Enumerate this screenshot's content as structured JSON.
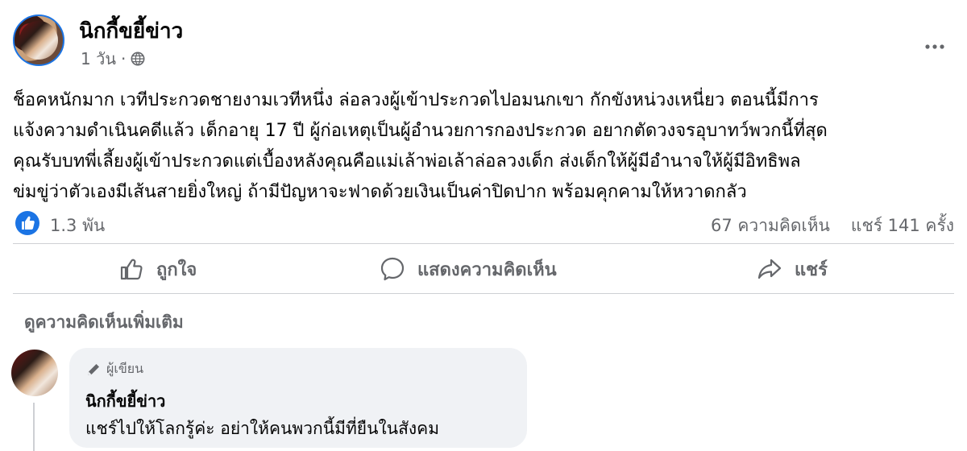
{
  "post": {
    "author": "นิกกี้ขยี้ข่าว",
    "time": "1 วัน",
    "separator": "·",
    "privacy_icon": "globe-icon",
    "more_icon": "more-horizontal-icon",
    "lines": [
      "ช็อคหนักมาก เวทีประกวดชายงามเวทีหนึ่ง ล่อลวงผู้เข้าประกวดไปอมนกเขา กักขังหน่วงเหนี่ยว ตอนนี้มีการ",
      "แจ้งความดำเนินคดีแล้ว เด็กอายุ 17 ปี ผู้ก่อเหตุเป็นผู้อำนวยการกองประกวด อยากตัดวงจรอุบาทว์พวกนี้ที่สุด",
      "คุณรับบทพี่เลี้ยงผู้เข้าประกวดแต่เบื้องหลังคุณคือแม่เล้าพ่อเล้าล่อลวงเด็ก ส่งเด็กให้ผู้มีอำนาจให้ผู้มีอิทธิพล",
      "ข่มขู่ว่าตัวเองมีเส้นสายยิ่งใหญ่ ถ้ามีปัญหาจะฟาดด้วยเงินเป็นค่าปิดปาก พร้อมคุกคามให้หวาดกลัว"
    ]
  },
  "stats": {
    "reactions": "1.3 พัน",
    "comments": "67 ความคิดเห็น",
    "shares": "แชร์ 141 ครั้ง"
  },
  "actions": {
    "like": "ถูกใจ",
    "comment": "แสดงความคิดเห็น",
    "share": "แชร์"
  },
  "comments_section": {
    "more_label": "ดูความคิดเห็นเพิ่มเติม",
    "comment": {
      "badge": "ผู้เขียน",
      "author": "นิกกี้ขยี้ข่าว",
      "text": "แชร์ไปให้โลกรู้ค่ะ อย่าให้คนพวกนี้มีที่ยืนในสังคม"
    }
  },
  "colors": {
    "accent": "#1b74e4",
    "secondary_text": "#65676b",
    "bubble_bg": "#f0f2f5"
  }
}
